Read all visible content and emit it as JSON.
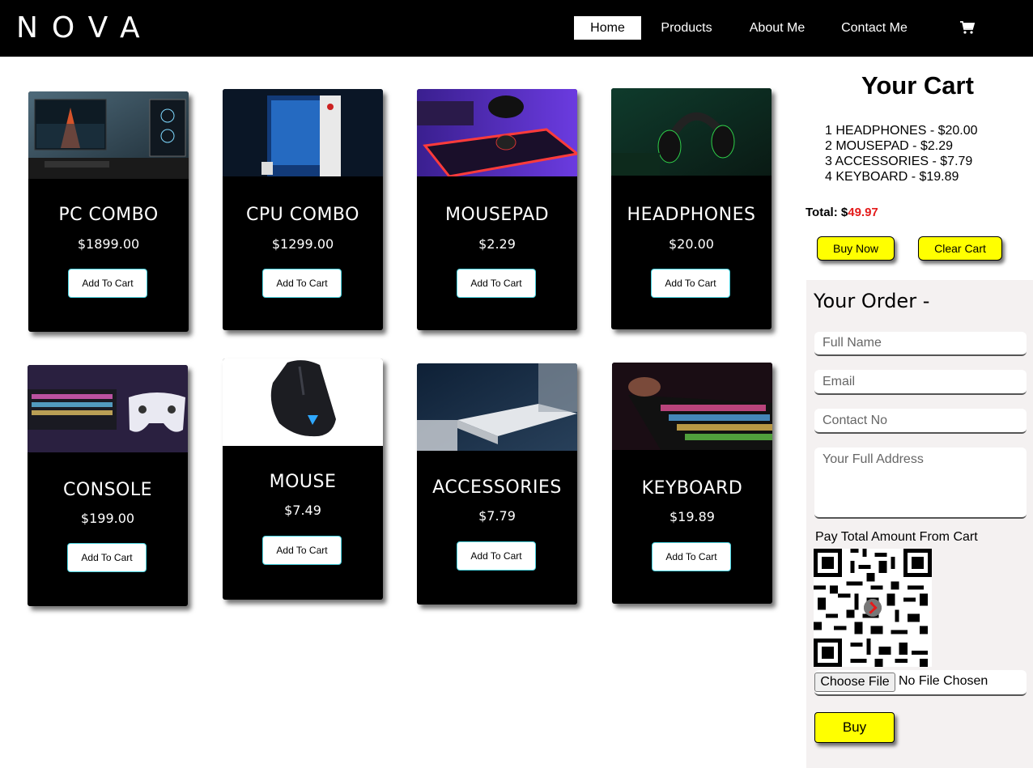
{
  "brand": {
    "logo": "NOVA"
  },
  "nav": {
    "items": [
      {
        "label": "Home",
        "active": true
      },
      {
        "label": "Products",
        "active": false
      },
      {
        "label": "About Me",
        "active": false
      },
      {
        "label": "Contact Me",
        "active": false
      }
    ],
    "cart_icon": "shopping-cart-icon"
  },
  "products": [
    {
      "title": "PC COMBO",
      "price": "$1899.00",
      "button": "Add To Cart"
    },
    {
      "title": "CPU COMBO",
      "price": "$1299.00",
      "button": "Add To Cart"
    },
    {
      "title": "MOUSEPAD",
      "price": "$2.29",
      "button": "Add To Cart"
    },
    {
      "title": "HEADPHONES",
      "price": "$20.00",
      "button": "Add To Cart"
    },
    {
      "title": "CONSOLE",
      "price": "$199.00",
      "button": "Add To Cart"
    },
    {
      "title": "MOUSE",
      "price": "$7.49",
      "button": "Add To Cart"
    },
    {
      "title": "ACCESSORIES",
      "price": "$7.79",
      "button": "Add To Cart"
    },
    {
      "title": "KEYBOARD",
      "price": "$19.89",
      "button": "Add To Cart"
    }
  ],
  "cart": {
    "title": "Your Cart",
    "items": [
      "1 HEADPHONES - $20.00",
      "2 MOUSEPAD - $2.29",
      "3 ACCESSORIES - $7.79",
      "4 KEYBOARD - $19.89"
    ],
    "total_label": "Total: $",
    "total_value": "49.97",
    "buy_now": "Buy Now",
    "clear_cart": "Clear Cart"
  },
  "order": {
    "title": "Your Order -",
    "full_name_placeholder": "Full Name",
    "email_placeholder": "Email",
    "contact_placeholder": "Contact No",
    "address_placeholder": "Your Full Address",
    "pay_label": "Pay Total Amount From Cart",
    "choose_file": "Choose File",
    "file_status": "No File Chosen",
    "buy": "Buy"
  },
  "colors": {
    "nav_bg": "#000000",
    "accent_yellow": "#ffff00",
    "total_red": "#e41b1b"
  }
}
